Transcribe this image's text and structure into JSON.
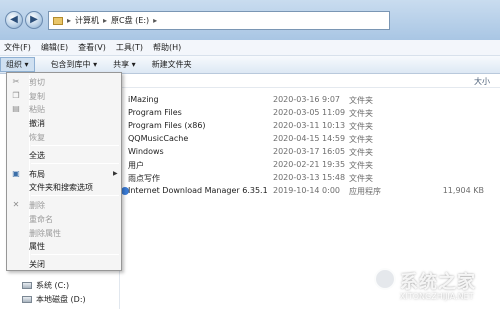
{
  "address_bar": {
    "segments": [
      "计算机",
      "原C盘 (E:)"
    ]
  },
  "menu_bar": {
    "items": [
      "文件(F)",
      "编辑(E)",
      "查看(V)",
      "工具(T)",
      "帮助(H)"
    ]
  },
  "toolbar": {
    "organize": "组织 ▾",
    "include_library": "包含到库中 ▾",
    "share": "共享 ▾",
    "new_folder": "新建文件夹"
  },
  "columns": {
    "size": "大小"
  },
  "files": [
    {
      "name": "iMazing",
      "date": "2020-03-16 9:07",
      "type": "文件夹",
      "size": ""
    },
    {
      "name": "Program Files",
      "date": "2020-03-05 11:09",
      "type": "文件夹",
      "size": ""
    },
    {
      "name": "Program Files (x86)",
      "date": "2020-03-11 10:13",
      "type": "文件夹",
      "size": ""
    },
    {
      "name": "QQMusicCache",
      "date": "2020-04-15 14:59",
      "type": "文件夹",
      "size": ""
    },
    {
      "name": "Windows",
      "date": "2020-03-17 16:05",
      "type": "文件夹",
      "size": ""
    },
    {
      "name": "用户",
      "date": "2020-02-21 19:35",
      "type": "文件夹",
      "size": ""
    },
    {
      "name": "雨点写作",
      "date": "2020-03-13 15:48",
      "type": "文件夹",
      "size": ""
    },
    {
      "name": "Internet Download Manager 6.35.1",
      "date": "2019-10-14 0:00",
      "type": "应用程序",
      "size": "11,904 KB"
    }
  ],
  "nav_pane": {
    "drives": [
      "系统 (C:)",
      "本地磁盘 (D:)"
    ]
  },
  "organize_menu": {
    "cut": "剪切",
    "copy": "复制",
    "paste": "粘贴",
    "undo": "撤消",
    "redo": "恢复",
    "select_all": "全选",
    "layout": "布局",
    "folder_options": "文件夹和搜索选项",
    "delete": "删除",
    "rename": "重命名",
    "remove_properties": "删除属性",
    "properties": "属性",
    "close": "关闭"
  },
  "watermark": {
    "text": "系统之家",
    "url": "XITONGZHIJIA.NET"
  }
}
